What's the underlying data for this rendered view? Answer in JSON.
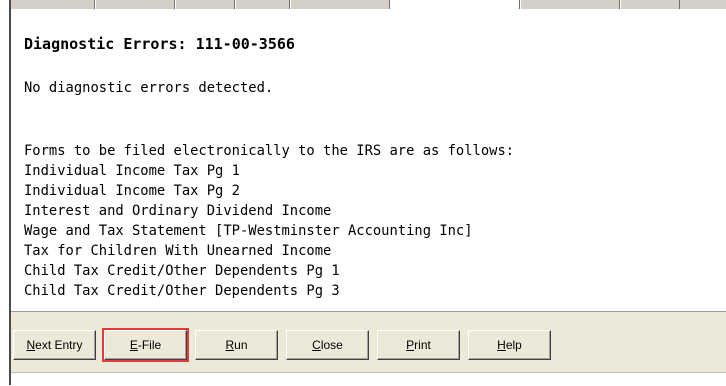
{
  "report": {
    "title": "Diagnostic Errors:  111-00-3566",
    "status": "No diagnostic errors detected.",
    "intro": "Forms to be filed electronically to the IRS are as follows:",
    "forms": [
      "Individual Income Tax Pg 1",
      "Individual Income Tax Pg 2",
      "Interest and Ordinary Dividend Income",
      "Wage and Tax Statement [TP-Westminster Accounting Inc]",
      "Tax for Children With Unearned Income",
      "Child Tax Credit/Other Dependents Pg 1",
      "Child Tax Credit/Other Dependents Pg 3"
    ]
  },
  "buttons": {
    "next_entry": {
      "accel": "N",
      "rest": "ext Entry"
    },
    "efile": {
      "accel": "E",
      "rest": "-File"
    },
    "run": {
      "accel": "R",
      "rest": "un"
    },
    "close": {
      "accel": "C",
      "rest": "lose"
    },
    "print": {
      "accel": "P",
      "rest": "rint"
    },
    "help": {
      "accel": "H",
      "rest": "elp"
    }
  },
  "colors": {
    "focus_outline": "#e23a3a",
    "button_face": "#ece9d8"
  }
}
